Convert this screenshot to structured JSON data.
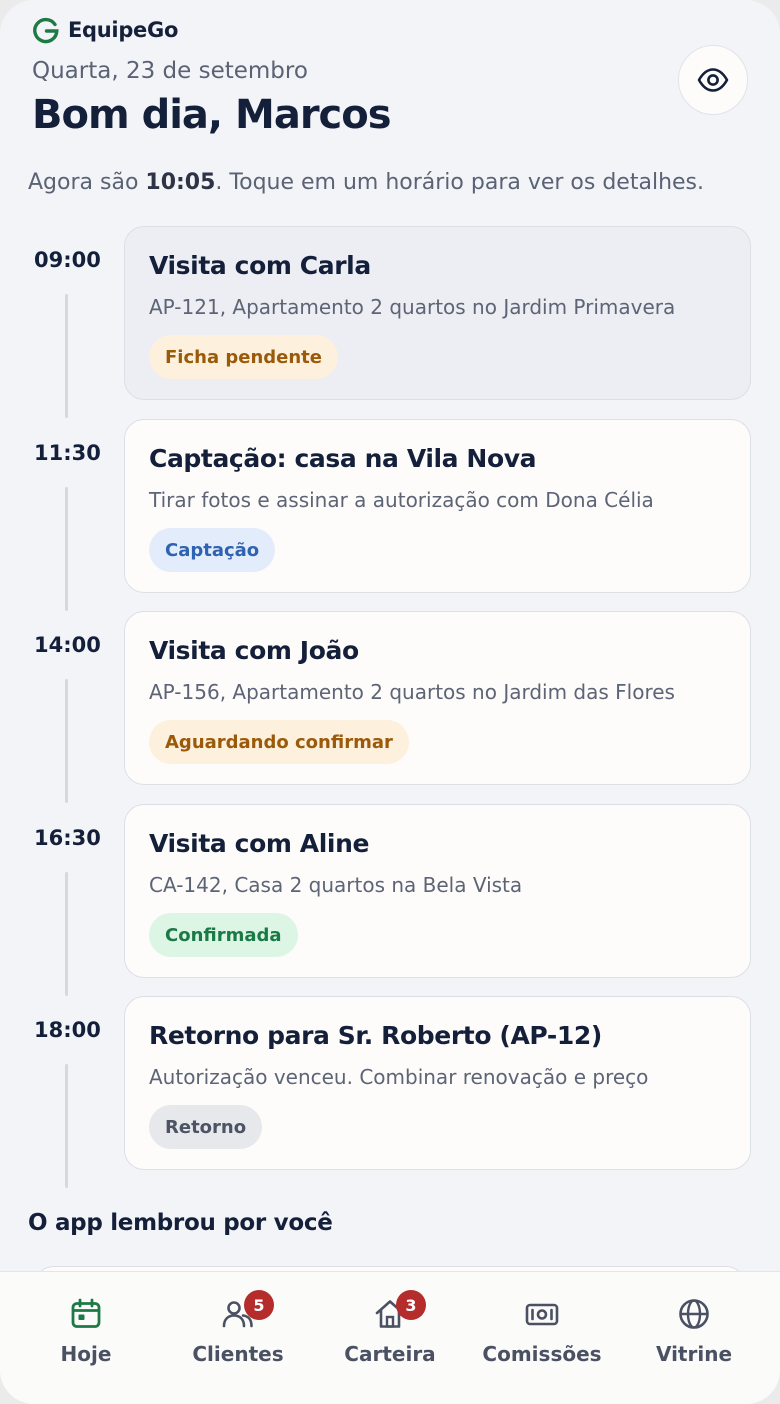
{
  "brand": {
    "name": "EquipeGo",
    "color": "#1d7a45"
  },
  "header": {
    "date": "Quarta, 23 de setembro",
    "greeting": "Bom dia, Marcos",
    "now_prefix": "Agora são ",
    "now_time": "10:05",
    "now_suffix": ". Toque em um horário para ver os detalhes."
  },
  "schedule": [
    {
      "time": "09:00",
      "title": "Visita com Carla",
      "subtitle": "AP-121, Apartamento 2 quartos no Jardim Primavera",
      "badge": "Ficha pendente",
      "badge_type": "warning",
      "active": true
    },
    {
      "time": "11:30",
      "title": "Captação: casa na Vila Nova",
      "subtitle": "Tirar fotos e assinar a autorização com Dona Célia",
      "badge": "Captação",
      "badge_type": "info",
      "active": false
    },
    {
      "time": "14:00",
      "title": "Visita com João",
      "subtitle": "AP-156, Apartamento 2 quartos no Jardim das Flores",
      "badge": "Aguardando confirmar",
      "badge_type": "warning",
      "active": false
    },
    {
      "time": "16:30",
      "title": "Visita com Aline",
      "subtitle": "CA-142, Casa 2 quartos na Bela Vista",
      "badge": "Confirmada",
      "badge_type": "success",
      "active": false
    },
    {
      "time": "18:00",
      "title": "Retorno para Sr. Roberto (AP-12)",
      "subtitle": "Autorização venceu. Combinar renovação e preço",
      "badge": "Retorno",
      "badge_type": "neutral",
      "active": false
    }
  ],
  "badge_colors": {
    "warning": {
      "bg": "#fdf0dd",
      "fg": "#9a5a0a"
    },
    "info": {
      "bg": "#e2ecfa",
      "fg": "#2f62b0"
    },
    "success": {
      "bg": "#dcf5e5",
      "fg": "#1a7a45"
    },
    "neutral": {
      "bg": "#e7e8ec",
      "fg": "#4d5365"
    }
  },
  "reminders": {
    "title": "O app lembrou por você"
  },
  "nav": {
    "items": [
      {
        "label": "Hoje",
        "icon": "calendar-icon",
        "active": true,
        "badge": ""
      },
      {
        "label": "Clientes",
        "icon": "users-icon",
        "active": false,
        "badge": "5"
      },
      {
        "label": "Carteira",
        "icon": "home-icon",
        "active": false,
        "badge": "3"
      },
      {
        "label": "Comissões",
        "icon": "money-icon",
        "active": false,
        "badge": ""
      },
      {
        "label": "Vitrine",
        "icon": "globe-icon",
        "active": false,
        "badge": ""
      }
    ]
  }
}
